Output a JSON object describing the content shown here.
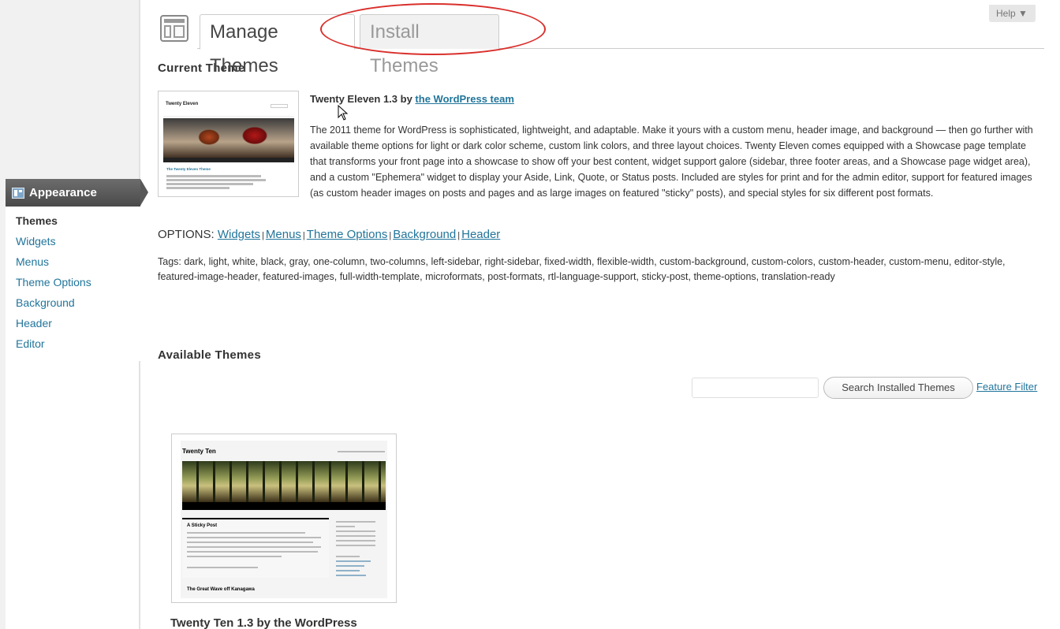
{
  "sidebar": {
    "menu_title": "Appearance",
    "items": [
      {
        "label": "Themes",
        "current": true
      },
      {
        "label": "Widgets"
      },
      {
        "label": "Menus"
      },
      {
        "label": "Theme Options"
      },
      {
        "label": "Background"
      },
      {
        "label": "Header"
      },
      {
        "label": "Editor"
      }
    ]
  },
  "header": {
    "tabs": [
      {
        "label": "Manage Themes",
        "active": true
      },
      {
        "label": "Install Themes",
        "active": false
      }
    ],
    "help_label": "Help ▼",
    "annotation_color": "#d9302c"
  },
  "current_theme": {
    "heading": "Current Theme",
    "thumb": {
      "title": "Twenty Eleven",
      "post_title": "The Twenty Eleven Theme"
    },
    "name": "Twenty Eleven 1.3 by ",
    "author": "the WordPress team",
    "description": "The 2011 theme for WordPress is sophisticated, lightweight, and adaptable. Make it yours with a custom menu, header image, and background — then go further with available theme options for light or dark color scheme, custom link colors, and three layout choices. Twenty Eleven comes equipped with a Showcase page template that transforms your front page into a showcase to show off your best content, widget support galore (sidebar, three footer areas, and a Showcase page widget area), and a custom \"Ephemera\" widget to display your Aside, Link, Quote, or Status posts. Included are styles for print and for the admin editor, support for featured images (as custom header images on posts and pages and as large images on featured \"sticky\" posts), and special styles for six different post formats.",
    "options_label": "OPTIONS: ",
    "options": [
      "Widgets",
      "Menus",
      "Theme Options",
      "Background",
      "Header"
    ],
    "option_separator": "|",
    "tags": "Tags: dark, light, white, black, gray, one-column, two-columns, left-sidebar, right-sidebar, fixed-width, flexible-width, custom-background, custom-colors, custom-header, custom-menu, editor-style, featured-image-header, featured-images, full-width-template, microformats, post-formats, rtl-language-support, sticky-post, theme-options, translation-ready"
  },
  "available": {
    "heading": "Available Themes",
    "search_value": "",
    "search_button": "Search Installed Themes",
    "feature_filter": "Feature Filter",
    "themes": [
      {
        "thumb_title": "Twenty Ten",
        "thumb_post": "A Sticky Post",
        "thumb_post2": "The Great Wave off Kanagawa",
        "caption": "Twenty Ten 1.3 by the WordPress"
      }
    ]
  },
  "colors": {
    "link": "#21759b",
    "menu_head": "#585858"
  }
}
